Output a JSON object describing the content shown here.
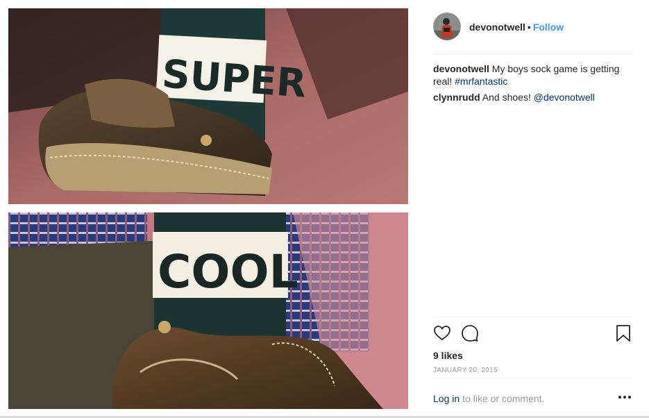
{
  "post": {
    "username": "devonotwell",
    "separator": "•",
    "follow_label": "Follow",
    "caption_user": "devonotwell",
    "caption_text": "My boys sock game is getting real!",
    "caption_hashtag": "#mrfantastic",
    "comment_user": "clynnrudd",
    "comment_text": "And shoes!",
    "comment_mention": "@devonotwell",
    "likes": "9 likes",
    "date": "JANUARY 20, 2015",
    "login_link": "Log in",
    "login_text": "to like or comment."
  },
  "photo": {
    "sock_text_top": "SUPER",
    "sock_text_bottom": "COOL"
  },
  "icons": {
    "like": "heart-icon",
    "comment": "comment-icon",
    "save": "bookmark-icon",
    "more": "more-options-icon"
  },
  "colors": {
    "follow": "#3897f0",
    "link": "#003569",
    "muted": "#999999",
    "text": "#262626"
  }
}
